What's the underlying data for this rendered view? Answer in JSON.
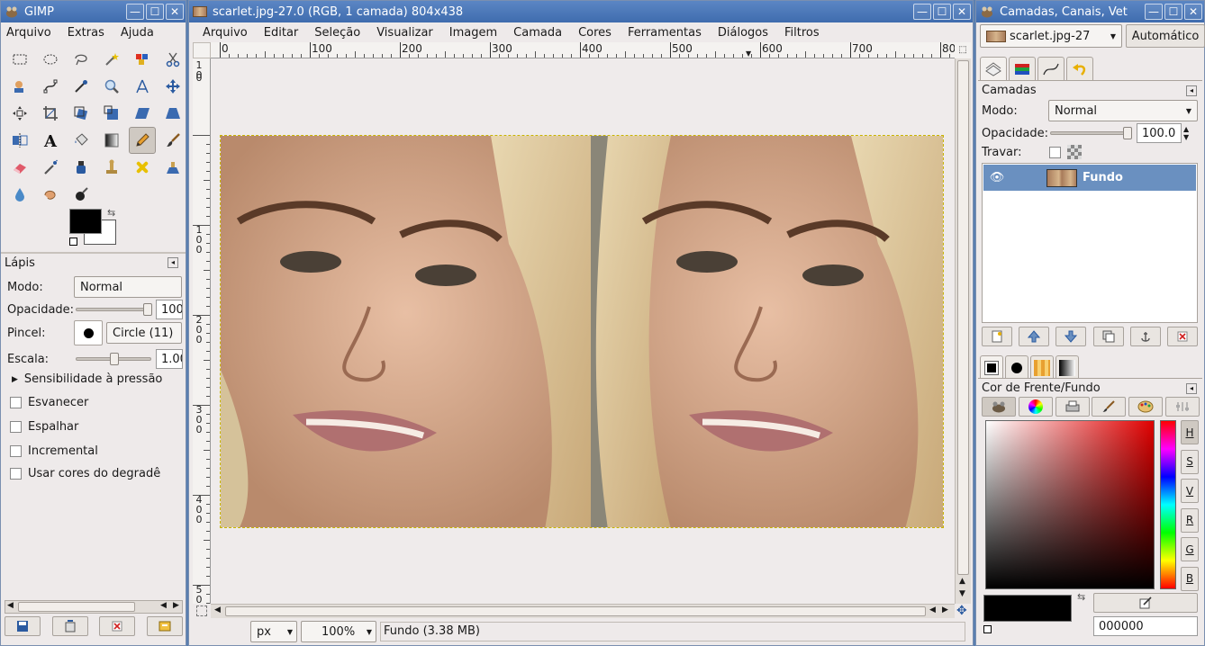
{
  "toolbox": {
    "title": "GIMP",
    "menu": [
      "Arquivo",
      "Extras",
      "Ajuda"
    ],
    "tools": [
      "rect-select",
      "ellipse-select",
      "free-select",
      "fuzzy-select",
      "color-select",
      "scissors",
      "foreground-select",
      "paths",
      "color-picker",
      "zoom",
      "measure",
      "move",
      "align",
      "crop",
      "rotate",
      "scale",
      "shear",
      "perspective",
      "flip",
      "text",
      "bucket-fill",
      "blend",
      "pencil",
      "paintbrush",
      "eraser",
      "airbrush",
      "ink",
      "clone",
      "heal",
      "perspective-clone",
      "blur",
      "smudge",
      "dodge-burn"
    ],
    "active_tool": "pencil",
    "fg_color": "#000000",
    "bg_color": "#ffffff"
  },
  "tool_options": {
    "title": "Lápis",
    "mode_label": "Modo:",
    "mode_value": "Normal",
    "opacity_label": "Opacidade:",
    "opacity_value": "100",
    "opacity_level": 1.0,
    "brush_label": "Pincel:",
    "brush_value": "Circle (11)",
    "scale_label": "Escala:",
    "scale_value": "1.00",
    "scale_level": 0.5,
    "pressure_label": "Sensibilidade à pressão",
    "checks": [
      "Esvanecer",
      "Espalhar",
      "Incremental",
      "Usar cores do degradê"
    ]
  },
  "image_window": {
    "title": "scarlet.jpg-27.0 (RGB, 1 camada) 804x438",
    "menu": [
      "Arquivo",
      "Editar",
      "Seleção",
      "Visualizar",
      "Imagem",
      "Camada",
      "Cores",
      "Ferramentas",
      "Diálogos",
      "Filtros"
    ],
    "hruler": [
      "0",
      "100",
      "200",
      "300",
      "400",
      "500",
      "600",
      "700",
      "80"
    ],
    "vruler": [
      "1\n0",
      "0",
      "1\n0\n0",
      "2\n0\n0",
      "3\n0\n0",
      "4\n0\n0",
      "5\n0"
    ],
    "unit": "px",
    "zoom": "100%",
    "status": "Fundo (3.38 MB)"
  },
  "layers": {
    "title": "Camadas, Canais, Vet",
    "image_select": "scarlet.jpg-27",
    "auto_button": "Automático",
    "panel_title": "Camadas",
    "mode_label": "Modo:",
    "mode_value": "Normal",
    "opacity_label": "Opacidade:",
    "opacity_value": "100.0",
    "opacity_level": 1.0,
    "lock_label": "Travar:",
    "layer_name": "Fundo"
  },
  "colors": {
    "panel_title": "Cor de Frente/Fundo",
    "channels": [
      "H",
      "S",
      "V",
      "R",
      "G",
      "B"
    ],
    "hex": "000000",
    "fg": "#000000"
  }
}
